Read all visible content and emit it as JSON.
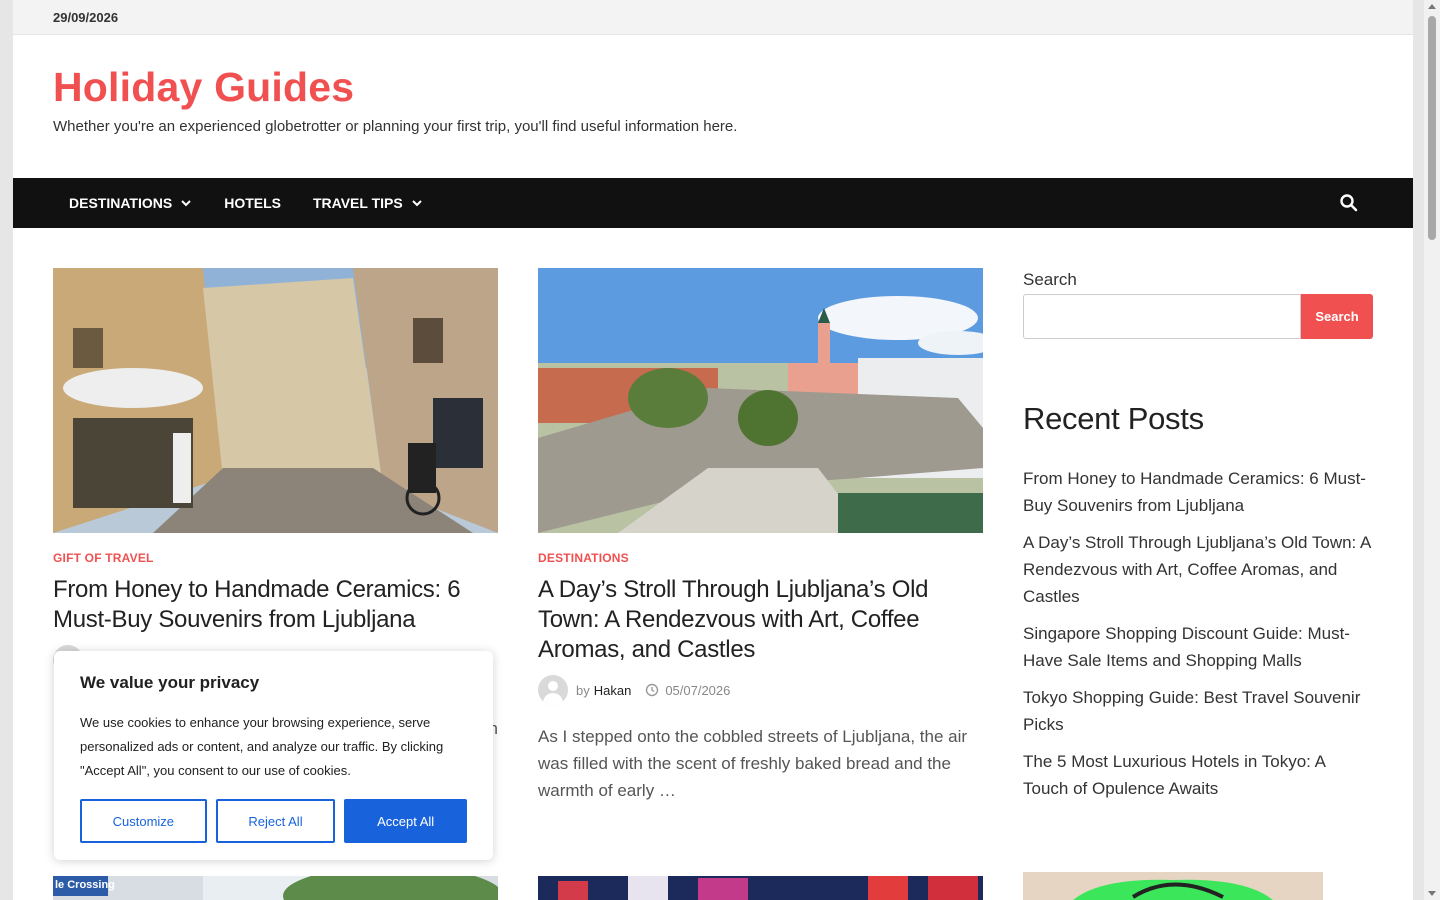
{
  "topbar": {
    "date": "29/09/2026"
  },
  "site": {
    "title": "Holiday Guides",
    "tagline": "Whether you're an experienced globetrotter or planning your first trip, you'll find useful information here."
  },
  "nav": {
    "items": [
      {
        "label": "DESTINATIONS",
        "has_dropdown": true
      },
      {
        "label": "HOTELS",
        "has_dropdown": false
      },
      {
        "label": "TRAVEL TIPS",
        "has_dropdown": true
      }
    ],
    "search_icon": "search-icon"
  },
  "posts": [
    {
      "category": "GIFT OF TRAVEL",
      "title": "From Honey to Handmade Ceramics: 6 Must-Buy Souvenirs from Ljubljana",
      "excerpt_visible_tail": "n"
    },
    {
      "category": "DESTINATIONS",
      "title": "A Day’s Stroll Through Ljubljana’s Old Town: A Rendezvous with Art, Coffee Aromas, and Castles",
      "meta": {
        "by": "by",
        "author": "Hakan",
        "date": "05/07/2026"
      },
      "excerpt": "As I stepped onto the cobbled streets of Ljubljana, the air was filled with the scent of freshly baked bread and the warmth of early …"
    }
  ],
  "sidebar": {
    "search_label": "Search",
    "search_placeholder": "",
    "search_button": "Search",
    "recent_title": "Recent Posts",
    "recent_posts": [
      "From Honey to Handmade Ceramics: 6 Must-Buy Souvenirs from Ljubljana",
      "A Day’s Stroll Through Ljubljana’s Old Town: A Rendezvous with Art, Coffee Aromas, and Castles",
      "Singapore Shopping Discount Guide: Must-Have Sale Items and Shopping Malls",
      "Tokyo Shopping Guide: Best Travel Souvenir Picks",
      "The 5 Most Luxurious Hotels in Tokyo: A Touch of Opulence Awaits"
    ]
  },
  "bottom_thumbs": {
    "left_sign_text": "le Crossing"
  },
  "cookie": {
    "title": "We value your privacy",
    "text": "We use cookies to enhance your browsing experience, serve personalized ads or content, and analyze our traffic. By clicking \"Accept All\", you consent to our use of cookies.",
    "customize": "Customize",
    "reject": "Reject All",
    "accept": "Accept All"
  },
  "colors": {
    "accent": "#f15050",
    "nav_bg": "#111111",
    "cookie_blue": "#1863dc"
  }
}
